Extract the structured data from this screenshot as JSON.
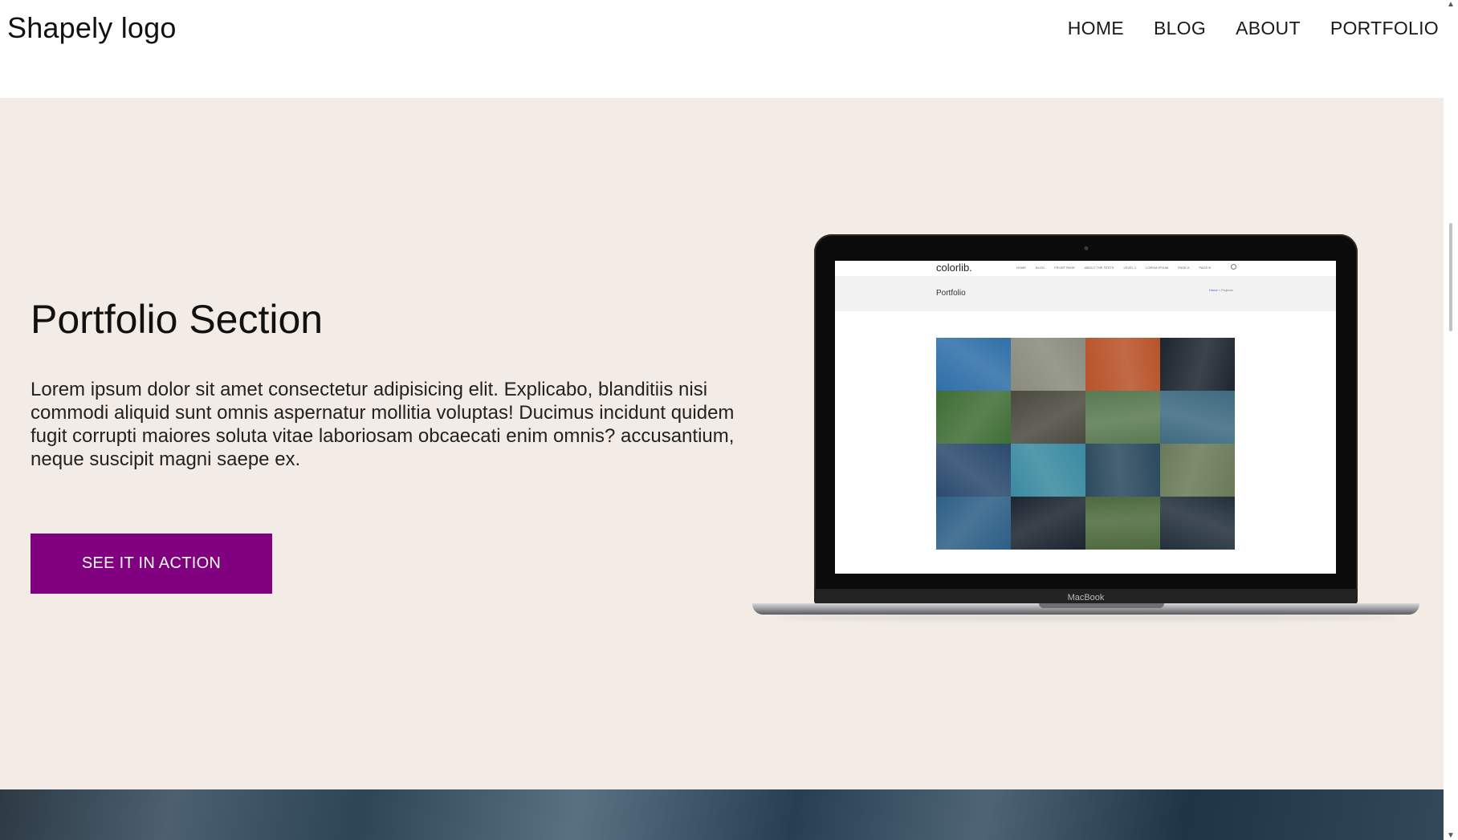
{
  "header": {
    "logo": "Shapely logo",
    "nav": [
      "HOME",
      "BLOG",
      "ABOUT",
      "PORTFOLIO"
    ]
  },
  "portfolio": {
    "title": "Portfolio Section",
    "body": "Lorem ipsum dolor sit amet consectetur adipisicing elit. Explicabo, blanditiis nisi\ncommodi aliquid sunt omnis aspernatur mollitia voluptas! Ducimus incidunt quidem fugit corrupti maiores soluta vitae laboriosam obcaecati enim omnis? accusantium, neque suscipit magni saepe ex.",
    "button": "SEE IT IN ACTION",
    "button_color": "#800080",
    "background": "#f3ece6"
  },
  "laptop": {
    "brand": "MacBook",
    "site_logo": "colorlib.",
    "site_nav": [
      "HOME",
      "BLOG",
      "FRONT PAGE",
      "ABOUT THE TESTS",
      "LEVEL 1",
      "LOREM IPSUM",
      "PAGE A",
      "PAGE B"
    ],
    "page_title": "Portfolio",
    "breadcrumb_home": "Home",
    "breadcrumb_rest": " » Projects",
    "tiles": [
      "#2f6fa8",
      "#8a8b7e",
      "#b8532a",
      "#1d2630",
      "#3f6e36",
      "#4a4a40",
      "#5a7a52",
      "#3e6a80",
      "#2a4a6e",
      "#3a8aa0",
      "#2c4a5e",
      "#6a7a58",
      "#2d5f86",
      "#1c2530",
      "#4e6a3e",
      "#23303c"
    ]
  },
  "scrollbar": {
    "up": "▲",
    "down": "▼"
  }
}
